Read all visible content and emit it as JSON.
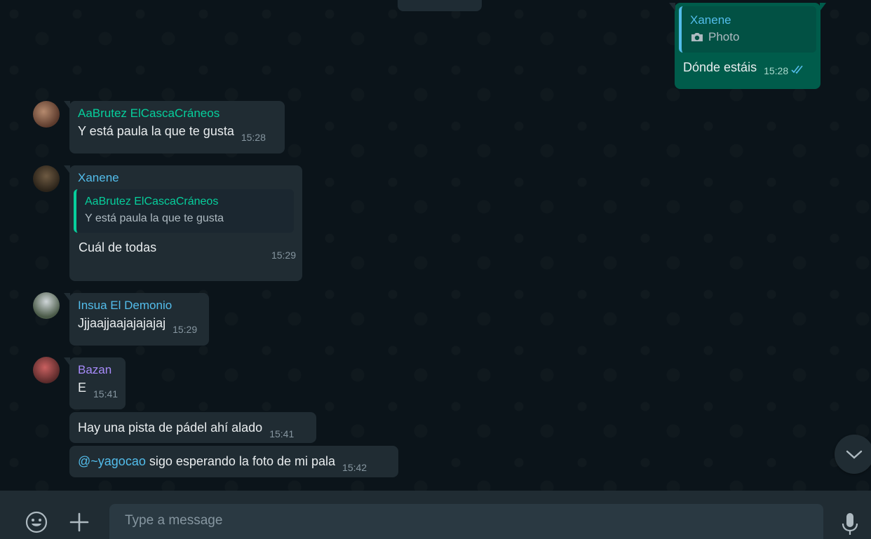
{
  "messages": [
    {
      "sender": "Xanene",
      "quote": {
        "label": "Photo"
      },
      "text": "Dónde estáis",
      "time": "15:28",
      "outgoing": true
    },
    {
      "sender": "AaBrutez ElCascaCráneos",
      "text": "Y está paula la que te gusta",
      "time": "15:28"
    },
    {
      "sender": "Xanene",
      "quote": {
        "sender": "AaBrutez ElCascaCráneos",
        "text": "Y está paula la que te gusta"
      },
      "text": "Cuál de todas",
      "time": "15:29"
    },
    {
      "sender": "Insua El Demonio",
      "text": "Jjjaajjaajajajajaj",
      "time": "15:29"
    },
    {
      "sender": "Bazan",
      "text": "E",
      "time": "15:41"
    },
    {
      "text": "Hay una pista de pádel ahí alado",
      "time": "15:41"
    },
    {
      "mention": "@~yagocao",
      "text": " sigo esperando la foto de mi pala",
      "time": "15:42"
    }
  ],
  "composer": {
    "placeholder": "Type a message"
  },
  "icons": [
    "emoji-icon",
    "plus-icon",
    "microphone-icon",
    "chevron-down-icon",
    "camera-icon",
    "double-check-icon"
  ],
  "colors": {
    "background": "#0b141a",
    "incoming_bubble": "#202c33",
    "outgoing_bubble": "#005c4b",
    "name_green": "#06cf9c",
    "name_blue": "#53bdeb",
    "name_purple": "#a78bfa",
    "mention": "#53bdeb"
  }
}
